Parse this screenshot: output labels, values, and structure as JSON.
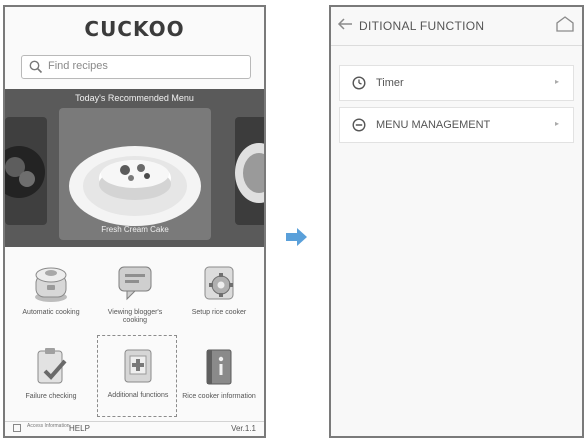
{
  "left_screen": {
    "brand": "CUCKOO",
    "search": {
      "placeholder": "Find recipes"
    },
    "banner": {
      "title": "Today's Recommended Menu",
      "caption": "Fresh Cream Cake"
    },
    "menu_tiles": [
      {
        "label": "Automatic cooking",
        "icon": "rice-cooker-icon"
      },
      {
        "label": "Viewing blogger's cooking",
        "icon": "chat-bubble-icon"
      },
      {
        "label": "Setup rice cooker",
        "icon": "settings-gear-icon"
      },
      {
        "label": "Failure checking",
        "icon": "clipboard-check-icon"
      },
      {
        "label": "Additional functions",
        "icon": "add-function-icon",
        "selected": true
      },
      {
        "label": "Rice cooker information",
        "icon": "info-book-icon"
      }
    ],
    "footer": {
      "small_text": "Access Information",
      "help": "HELP",
      "version": "Ver.1.1"
    }
  },
  "arrow_icon": "right-arrow-icon",
  "right_screen": {
    "title": "DITIONAL FUNCTION",
    "back_icon": "back-arrow-icon",
    "home_icon": "home-icon",
    "items": [
      {
        "label": "Timer",
        "icon": "clock-icon",
        "chevron": "▸"
      },
      {
        "label": "MENU MANAGEMENT",
        "icon": "minus-circle-icon",
        "chevron": "▸"
      }
    ]
  },
  "colors": {
    "arrow": "#5aa0da",
    "banner_bg": "#5a5a5a",
    "frame": "#7a7a7a"
  }
}
